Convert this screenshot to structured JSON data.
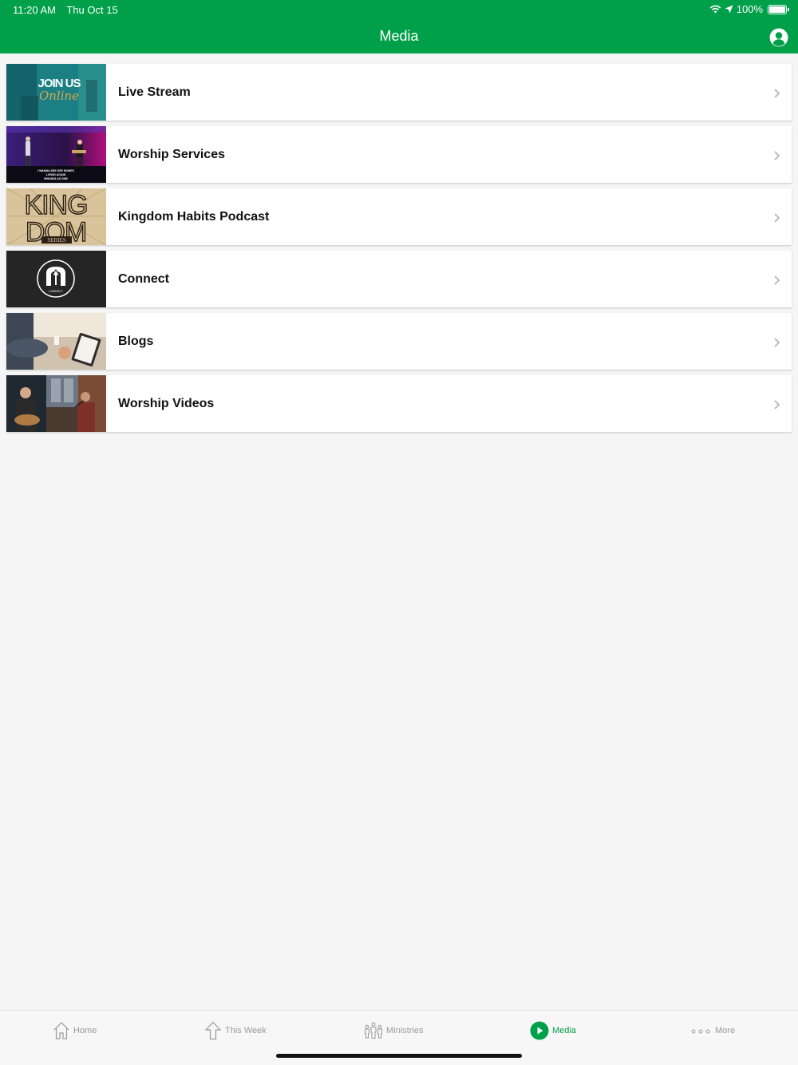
{
  "status": {
    "time": "11:20 AM",
    "date": "Thu Oct 15",
    "battery": "100%"
  },
  "header": {
    "title": "Media"
  },
  "thumbnails": {
    "live_stream": {
      "line1": "JOIN US",
      "line2": "Online"
    },
    "worship_services": {
      "caption1": "I WANNA SEE DRY BONES",
      "caption2": "LIVING AGAIN",
      "caption3": "SINGING AS ONE"
    },
    "kingdom": {
      "line1": "KING",
      "line2": "DOM",
      "line3": "SERIES"
    },
    "connect": {
      "caption": "CONNECT"
    }
  },
  "items": [
    {
      "label": "Live Stream"
    },
    {
      "label": "Worship Services"
    },
    {
      "label": "Kingdom Habits Podcast"
    },
    {
      "label": "Connect"
    },
    {
      "label": "Blogs"
    },
    {
      "label": "Worship Videos"
    }
  ],
  "tabs": [
    {
      "label": "Home"
    },
    {
      "label": "This Week"
    },
    {
      "label": "Ministries"
    },
    {
      "label": "Media"
    },
    {
      "label": "More"
    }
  ],
  "colors": {
    "brand_green": "#00a04a",
    "background": "#f5f5f5"
  }
}
